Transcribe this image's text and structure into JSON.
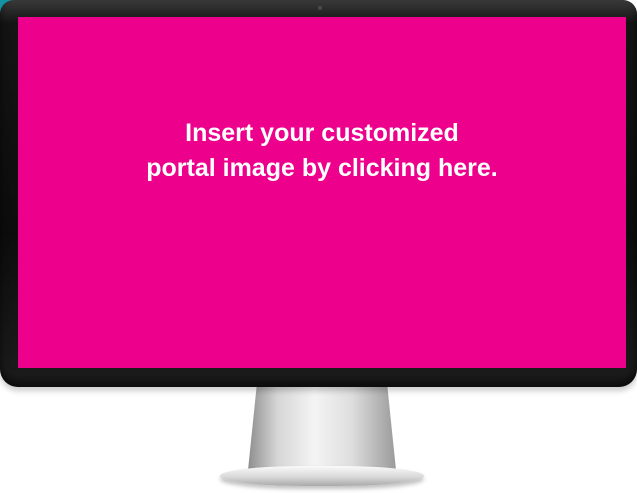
{
  "portal": {
    "line1": "Insert your customized",
    "line2": "portal image by clicking here."
  },
  "colors": {
    "screen": "#ec008c",
    "text": "#ffffff",
    "bezel": "#0c0c0c",
    "accent": "#1493a3"
  },
  "icons": {
    "camera": "webcam-dot"
  }
}
